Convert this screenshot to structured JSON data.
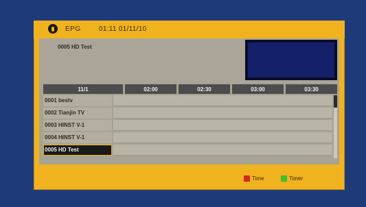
{
  "header": {
    "title": "EPG",
    "datetime": "01:11 01/11/10"
  },
  "info": {
    "channel_title": "0005 HD Test"
  },
  "timebar": [
    "11/1",
    "02:00",
    "02:30",
    "03:00",
    "03:30"
  ],
  "channels": [
    {
      "label": "0001 bestv",
      "selected": false
    },
    {
      "label": "0002 Tianjin TV",
      "selected": false
    },
    {
      "label": "0003 HINST V-1",
      "selected": false
    },
    {
      "label": "0004 HINST V-1",
      "selected": false
    },
    {
      "label": "0005 HD Test",
      "selected": true
    }
  ],
  "footer": {
    "legend_red": "Time",
    "legend_green": "Timer"
  },
  "colors": {
    "background": "#1f3a78",
    "frame": "#f0b21f",
    "panel": "#a6a294",
    "preview": "#15206b",
    "red": "#d22a1f",
    "green": "#3fbf2f"
  }
}
